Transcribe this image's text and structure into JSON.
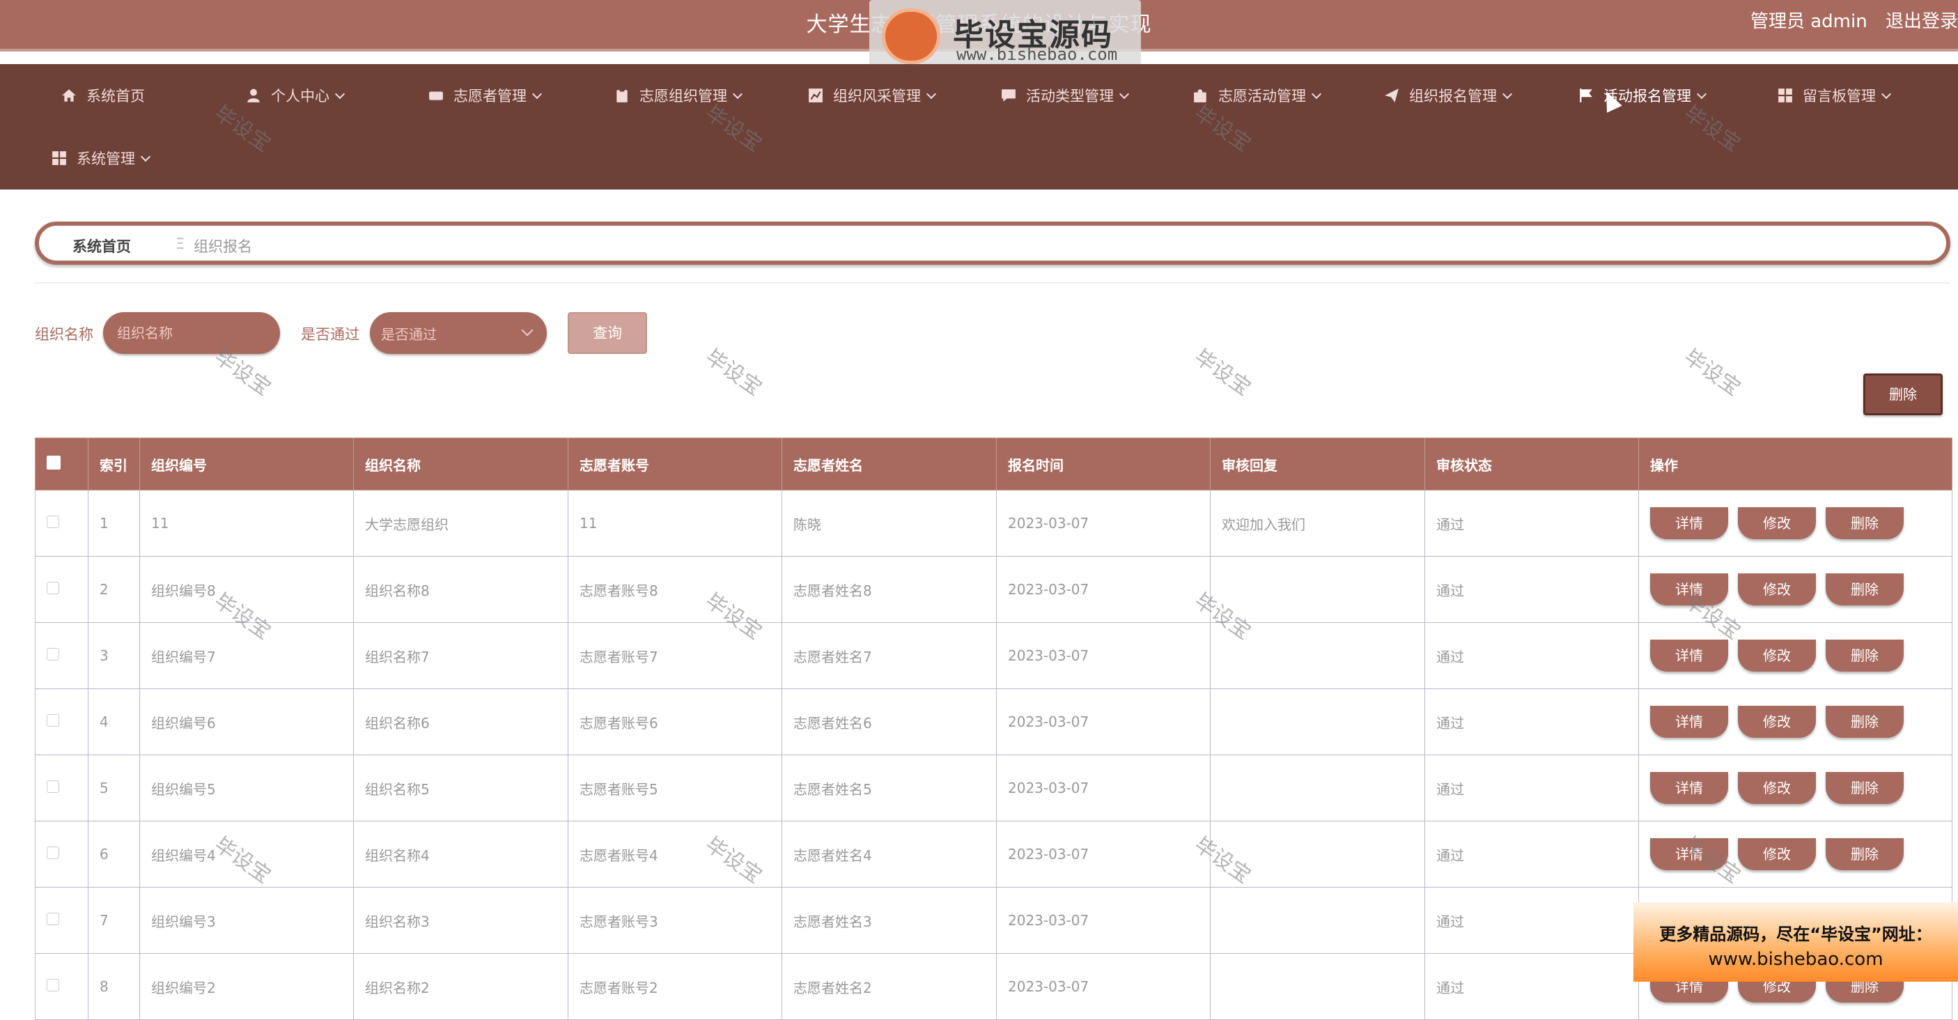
{
  "header": {
    "title": "大学生志愿者管理系统的设计与实现",
    "user_label": "管理员 admin",
    "logout_label": "退出登录"
  },
  "watermark_logo": {
    "name": "毕设宝源码网",
    "url": "www.bishebao.com"
  },
  "nav": {
    "items": [
      {
        "label": "系统首页",
        "icon": "home-icon"
      },
      {
        "label": "个人中心",
        "icon": "user-icon"
      },
      {
        "label": "志愿者管理",
        "icon": "team-icon"
      },
      {
        "label": "志愿组织管理",
        "icon": "clipboard-icon"
      },
      {
        "label": "组织风采管理",
        "icon": "chart-icon"
      },
      {
        "label": "活动类型管理",
        "icon": "chat-icon"
      },
      {
        "label": "志愿活动管理",
        "icon": "puzzle-icon"
      },
      {
        "label": "组织报名管理",
        "icon": "send-icon"
      },
      {
        "label": "活动报名管理",
        "icon": "flag-icon"
      },
      {
        "label": "留言板管理",
        "icon": "grid-icon"
      },
      {
        "label": "系统管理",
        "icon": "grid-icon"
      }
    ]
  },
  "breadcrumb": {
    "home": "系统首页",
    "separator": "Ξ",
    "current": "组织报名"
  },
  "search": {
    "name_label": "组织名称",
    "name_placeholder": "组织名称",
    "pass_label": "是否通过",
    "pass_value": "是否通过",
    "query_button": "查询"
  },
  "actions": {
    "delete_button": "删除"
  },
  "table": {
    "headers": [
      "索引",
      "组织编号",
      "组织名称",
      "志愿者账号",
      "志愿者姓名",
      "报名时间",
      "审核回复",
      "审核状态",
      "操作"
    ],
    "op_labels": {
      "detail": "详情",
      "edit": "修改",
      "delete": "删除"
    },
    "rows": [
      {
        "index": "1",
        "org_no": "11",
        "org_name": "大学志愿组织",
        "account": "11",
        "vol_name": "陈晓",
        "time": "2023-03-07",
        "reply": "欢迎加入我们",
        "status": "通过"
      },
      {
        "index": "2",
        "org_no": "组织编号8",
        "org_name": "组织名称8",
        "account": "志愿者账号8",
        "vol_name": "志愿者姓名8",
        "time": "2023-03-07",
        "reply": "",
        "status": "通过"
      },
      {
        "index": "3",
        "org_no": "组织编号7",
        "org_name": "组织名称7",
        "account": "志愿者账号7",
        "vol_name": "志愿者姓名7",
        "time": "2023-03-07",
        "reply": "",
        "status": "通过"
      },
      {
        "index": "4",
        "org_no": "组织编号6",
        "org_name": "组织名称6",
        "account": "志愿者账号6",
        "vol_name": "志愿者姓名6",
        "time": "2023-03-07",
        "reply": "",
        "status": "通过"
      },
      {
        "index": "5",
        "org_no": "组织编号5",
        "org_name": "组织名称5",
        "account": "志愿者账号5",
        "vol_name": "志愿者姓名5",
        "time": "2023-03-07",
        "reply": "",
        "status": "通过"
      },
      {
        "index": "6",
        "org_no": "组织编号4",
        "org_name": "组织名称4",
        "account": "志愿者账号4",
        "vol_name": "志愿者姓名4",
        "time": "2023-03-07",
        "reply": "",
        "status": "通过"
      },
      {
        "index": "7",
        "org_no": "组织编号3",
        "org_name": "组织名称3",
        "account": "志愿者账号3",
        "vol_name": "志愿者姓名3",
        "time": "2023-03-07",
        "reply": "",
        "status": "通过"
      },
      {
        "index": "8",
        "org_no": "组织编号2",
        "org_name": "组织名称2",
        "account": "志愿者账号2",
        "vol_name": "志愿者姓名2",
        "time": "2023-03-07",
        "reply": "",
        "status": "通过"
      }
    ]
  },
  "overlay_watermark": "毕设宝",
  "ad": {
    "line1": "更多精品源码，尽在“毕设宝”网址：",
    "line2": "www.bishebao.com"
  },
  "colors": {
    "primary": "#a86a5e",
    "nav_bg": "#6d4038",
    "row_border": "#b9b7d0"
  }
}
